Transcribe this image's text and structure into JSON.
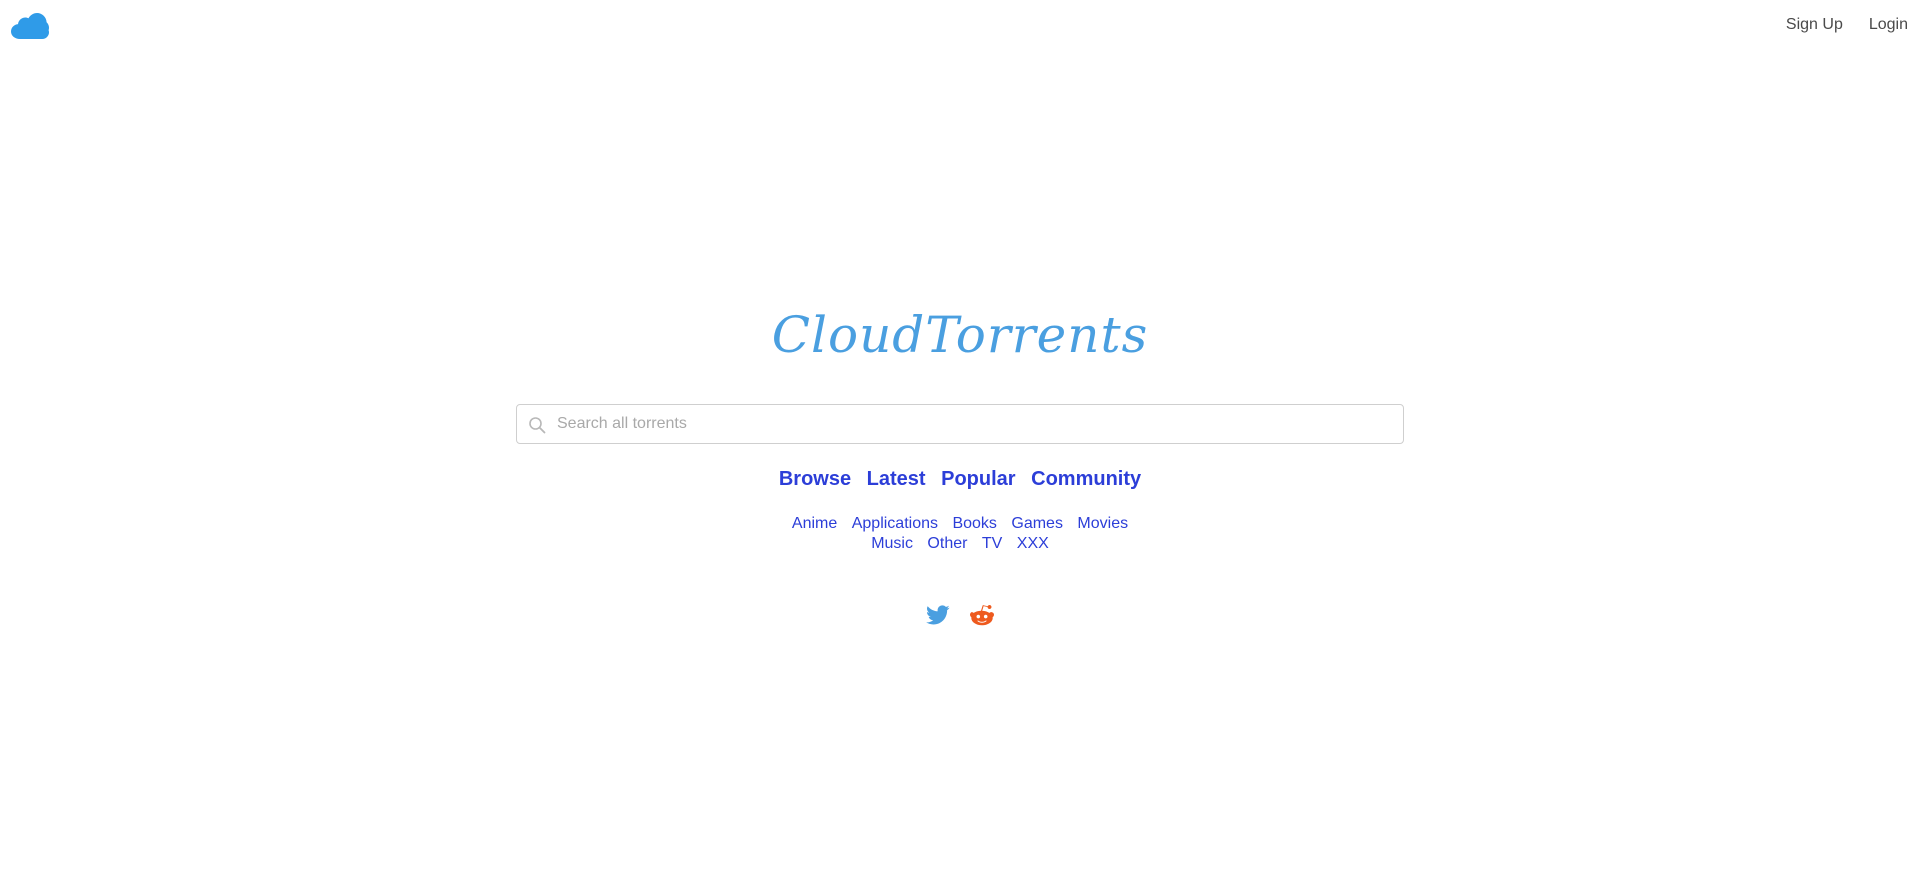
{
  "header": {
    "logo_icon": "cloud-icon",
    "nav": [
      {
        "label": "Sign Up"
      },
      {
        "label": "Login"
      }
    ]
  },
  "brand": {
    "title": "CloudTorrents",
    "color": "#4a9fe0"
  },
  "search": {
    "placeholder": "Search all torrents",
    "value": "",
    "icon": "search-icon"
  },
  "main_nav": [
    {
      "label": "Browse"
    },
    {
      "label": "Latest"
    },
    {
      "label": "Popular"
    },
    {
      "label": "Community"
    }
  ],
  "categories_row1": [
    {
      "label": "Anime"
    },
    {
      "label": "Applications"
    },
    {
      "label": "Books"
    },
    {
      "label": "Games"
    },
    {
      "label": "Movies"
    }
  ],
  "categories_row2": [
    {
      "label": "Music"
    },
    {
      "label": "Other"
    },
    {
      "label": "TV"
    },
    {
      "label": "XXX"
    }
  ],
  "social": [
    {
      "icon": "twitter-icon",
      "color": "#4a9fe0"
    },
    {
      "icon": "reddit-icon",
      "color": "#ee5a1e"
    }
  ],
  "colors": {
    "link": "#2c3ed8",
    "header_link": "#4a4a4a",
    "cloud": "#2f9be8"
  }
}
